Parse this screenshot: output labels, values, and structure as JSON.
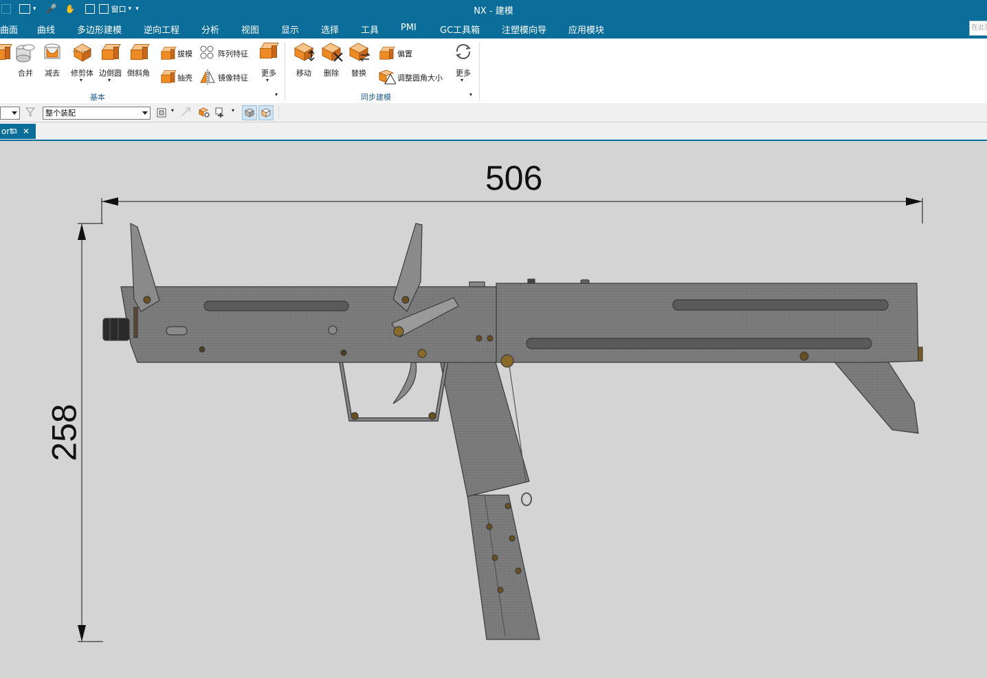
{
  "window": {
    "title": "NX - 建模",
    "search_placeholder": "在此键入"
  },
  "quick_access": {
    "window_menu": "窗口"
  },
  "menu": [
    "曲面",
    "曲线",
    "多边形建模",
    "逆向工程",
    "分析",
    "视图",
    "显示",
    "选择",
    "工具",
    "PMI",
    "GC工具箱",
    "注塑模向导",
    "应用模块"
  ],
  "ribbon": {
    "basic": {
      "group_label": "基本",
      "combine": "合并",
      "subtract": "减去",
      "trim_body": "修剪体",
      "edge_blend": "边倒圆",
      "chamfer": "倒斜角",
      "draft": "拔模",
      "shell": "抽壳",
      "pattern_feature": "阵列特征",
      "mirror_feature": "镜像特征",
      "more": "更多"
    },
    "sync": {
      "group_label": "同步建模",
      "move": "移动",
      "delete": "删除",
      "replace": "替换",
      "offset": "偏置",
      "resize_blend": "调整圆角大小",
      "more": "更多"
    }
  },
  "selection_bar": {
    "scope_value": "整个装配"
  },
  "tab": {
    "label": "ort"
  },
  "viewport": {
    "dim_horizontal": "506",
    "dim_vertical": "258"
  }
}
